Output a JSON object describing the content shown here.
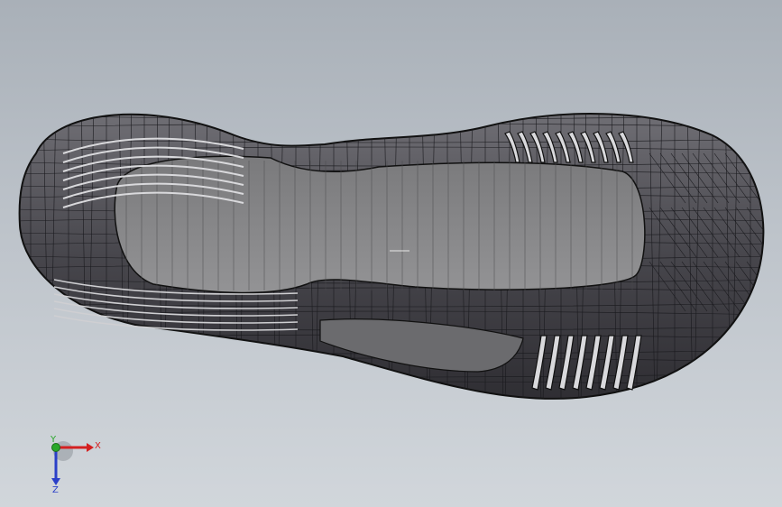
{
  "viewport": {
    "background_top": "#a9b0b8",
    "background_bottom": "#d1d6db",
    "model_fill_dark": "#3c3b41",
    "model_fill_mid": "#5e5d63",
    "insole_fill": "#8a8a8c",
    "edge_color": "#111111"
  },
  "triad": {
    "x_label": "X",
    "y_label": "Y",
    "z_label": "Z",
    "x_color": "#d42020",
    "y_color": "#2aa82a",
    "z_color": "#2a3fc8"
  }
}
